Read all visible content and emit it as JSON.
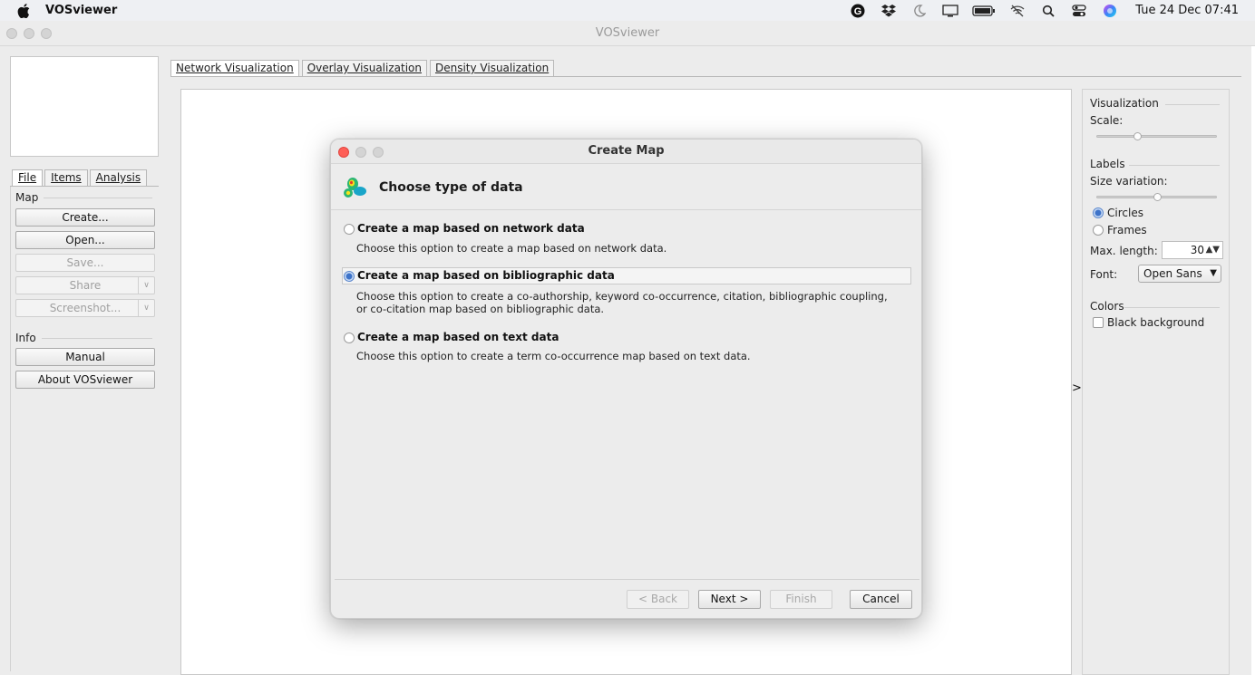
{
  "menubar": {
    "app_name": "VOSviewer",
    "clock": "Tue 24 Dec  07:41",
    "icons": [
      "grammarly-icon",
      "dropbox-icon",
      "moon-icon",
      "display-icon",
      "battery-icon",
      "wifi-off-icon",
      "search-icon",
      "control-center-icon",
      "siri-icon"
    ]
  },
  "window": {
    "title": "VOSviewer"
  },
  "left": {
    "tabs": [
      "File",
      "Items",
      "Analysis"
    ],
    "map_section": "Map",
    "buttons": {
      "create": "Create...",
      "open": "Open...",
      "save": "Save...",
      "share": "Share",
      "screenshot": "Screenshot..."
    },
    "info_section": "Info",
    "info_buttons": {
      "manual": "Manual",
      "about": "About VOSviewer"
    }
  },
  "main": {
    "tabs": [
      "Network Visualization",
      "Overlay Visualization",
      "Density Visualization"
    ],
    "expander": ">"
  },
  "right": {
    "visualization": "Visualization",
    "scale": "Scale:",
    "scale_level": 0.32,
    "labels": "Labels",
    "size_variation": "Size variation:",
    "size_variation_level": 0.5,
    "circles": "Circles",
    "frames": "Frames",
    "max_length_label": "Max. length:",
    "max_length": "30",
    "font_label": "Font:",
    "font": "Open Sans",
    "colors": "Colors",
    "black_background": "Black background"
  },
  "dialog": {
    "title": "Create Map",
    "heading": "Choose type of data",
    "options": [
      {
        "label": "Create a map based on network data",
        "desc": "Choose this option to create a map based on network data."
      },
      {
        "label": "Create a map based on bibliographic data",
        "desc": "Choose this option to create a co-authorship, keyword co-occurrence, citation, bibliographic coupling, or co-citation map based on bibliographic data."
      },
      {
        "label": "Create a map based on text data",
        "desc": "Choose this option to create a term co-occurrence map based on text data."
      }
    ],
    "selected_option": 1,
    "buttons": {
      "back": "< Back",
      "next": "Next >",
      "finish": "Finish",
      "cancel": "Cancel"
    }
  },
  "colors": {
    "accent": "#3d73c9",
    "close_red": "#fe5f57"
  }
}
